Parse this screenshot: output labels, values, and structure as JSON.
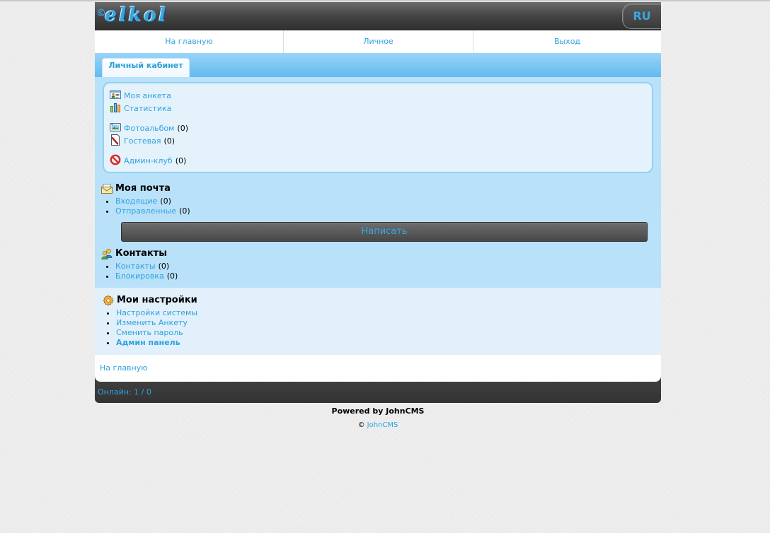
{
  "header": {
    "logo_symbol": "©",
    "logo_text": "elkol",
    "lang_button": "RU"
  },
  "nav": [
    {
      "label": "На главную"
    },
    {
      "label": "Личное"
    },
    {
      "label": "Выход"
    }
  ],
  "tab": {
    "label": "Личный кабинет"
  },
  "cabinet": {
    "items": [
      {
        "label": "Моя анкета",
        "icon": "profile-card-icon"
      },
      {
        "label": "Статистика",
        "icon": "statistics-icon"
      },
      {
        "label": "Фотоальбом",
        "count": "(0)",
        "icon": "photo-album-icon"
      },
      {
        "label": "Гостевая",
        "count": "(0)",
        "icon": "guestbook-icon"
      },
      {
        "label": "Админ-клуб",
        "count": "(0)",
        "icon": "admin-club-icon"
      }
    ]
  },
  "mail": {
    "title": "Моя почта",
    "icon": "mail-icon",
    "items": [
      {
        "label": "Входящие",
        "count": "(0)"
      },
      {
        "label": "Отправленные",
        "count": "(0)"
      }
    ],
    "compose_button": "Написать"
  },
  "contacts": {
    "title": "Контакты",
    "icon": "contacts-icon",
    "items": [
      {
        "label": "Контакты",
        "count": "(0)"
      },
      {
        "label": "Блокировка",
        "count": "(0)"
      }
    ]
  },
  "settings": {
    "title": "Мои настройки",
    "icon": "settings-icon",
    "items": [
      {
        "label": "Настройки системы"
      },
      {
        "label": "Изменить Анкету"
      },
      {
        "label": "Сменить пароль"
      },
      {
        "label": "Админ панель"
      }
    ]
  },
  "footer": {
    "home_link": "На главную",
    "online": "Онлайн: 1 / 0"
  },
  "powered": {
    "text": "Powered by JohnCMS",
    "copyright_symbol": "©",
    "copyright_link": "JohnCMS"
  },
  "colors": {
    "link": "#2fa3e0",
    "header_dark": "#3c3c3c",
    "tab_bar": "#6fc1f1",
    "panel": "#b9e1f9",
    "inner_box": "#e4f2fc",
    "settings_bg": "#e1f0fb"
  }
}
